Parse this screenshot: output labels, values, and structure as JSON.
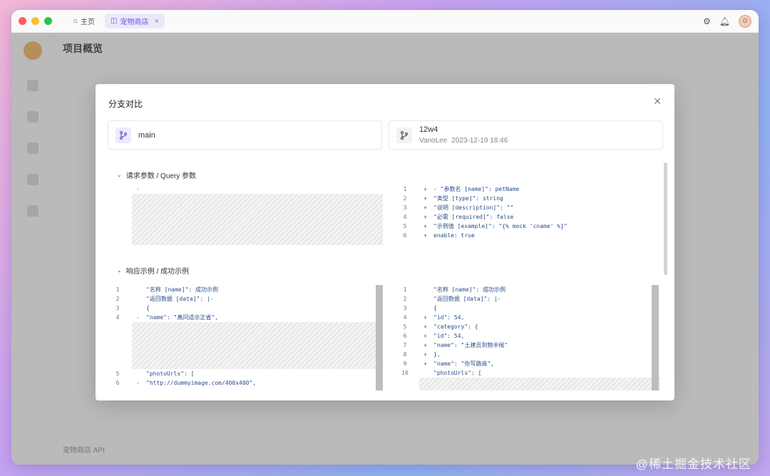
{
  "titlebar": {
    "tabs": [
      {
        "label": "主页"
      },
      {
        "label": "宠物商店"
      }
    ]
  },
  "background": {
    "heading": "项目概览",
    "footer": "宠物商店 API"
  },
  "modal": {
    "title": "分支对比",
    "left_branch": {
      "name": "main"
    },
    "right_branch": {
      "name": "12w4",
      "author": "VanoLee",
      "datetime": "2023-12-19 18:46"
    },
    "sections": [
      {
        "title": "请求参数 / Query 参数"
      },
      {
        "title": "响应示例 / 成功示例"
      }
    ]
  },
  "diff1": {
    "left_marker": "-",
    "right_lines": [
      {
        "num": "1",
        "mark": "+",
        "text": "- \"参数名 [name]\": petName"
      },
      {
        "num": "2",
        "mark": "+",
        "text": "  \"类型 [type]\": string"
      },
      {
        "num": "3",
        "mark": "+",
        "text": "  \"说明 [description]\": \"\""
      },
      {
        "num": "4",
        "mark": "+",
        "text": "  \"必需 [required]\": false"
      },
      {
        "num": "5",
        "mark": "+",
        "text": "  \"示例值 [example]\": \"{% mock 'cname' %}\""
      },
      {
        "num": "6",
        "mark": "+",
        "text": "  enable: true"
      }
    ]
  },
  "diff2": {
    "left_lines": [
      {
        "num": "1",
        "mark": "",
        "text": "\"名称 [name]\": 成功示例",
        "type": "ctx"
      },
      {
        "num": "2",
        "mark": "",
        "text": "\"返回数据 [data]\": |-",
        "type": "ctx"
      },
      {
        "num": "3",
        "mark": "",
        "text": "    {",
        "type": "ctx"
      },
      {
        "num": "4",
        "mark": "-",
        "text": "        \"name\": \"离问适示正省\",",
        "type": "del"
      }
    ],
    "left_after": [
      {
        "num": "5",
        "mark": "",
        "text": "        \"photoUrls\": [",
        "type": "ctx"
      },
      {
        "num": "6",
        "mark": "-",
        "text": "            \"http://dummyimage.com/400x400\",",
        "type": "del"
      }
    ],
    "right_lines": [
      {
        "num": "1",
        "mark": "",
        "text": "\"名称 [name]\": 成功示例",
        "type": "ctx"
      },
      {
        "num": "2",
        "mark": "",
        "text": "\"返回数据 [data]\": |-",
        "type": "ctx"
      },
      {
        "num": "3",
        "mark": "",
        "text": "    {",
        "type": "ctx"
      },
      {
        "num": "4",
        "mark": "+",
        "text": "        \"id\": 54,",
        "type": "add"
      },
      {
        "num": "5",
        "mark": "+",
        "text": "        \"category\": {",
        "type": "add"
      },
      {
        "num": "6",
        "mark": "+",
        "text": "            \"id\": 54,",
        "type": "add"
      },
      {
        "num": "7",
        "mark": "+",
        "text": "            \"name\": \"土建员到物半候\"",
        "type": "add"
      },
      {
        "num": "8",
        "mark": "+",
        "text": "        },",
        "type": "add"
      },
      {
        "num": "9",
        "mark": "+",
        "text": "        \"name\": \"你写路商\",",
        "type": "add"
      },
      {
        "num": "10",
        "mark": "",
        "text": "        \"photoUrls\": [",
        "type": "ctx"
      }
    ]
  },
  "watermark": "@稀土掘金技术社区"
}
